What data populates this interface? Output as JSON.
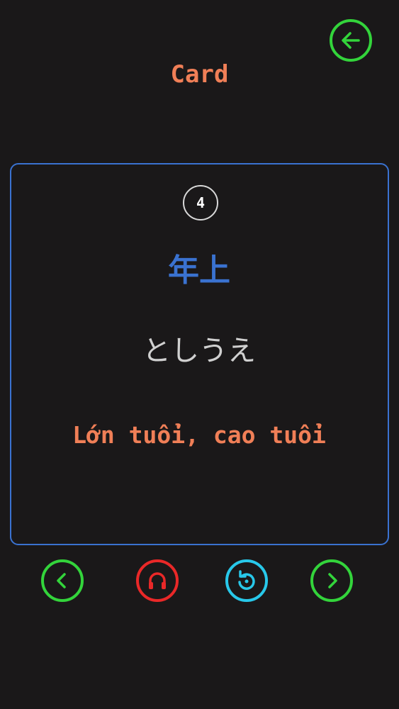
{
  "header": {
    "title": "Card"
  },
  "card": {
    "number": "4",
    "kanji": "年上",
    "reading": "としうえ",
    "meaning": "Lớn tuổi, cao tuổi"
  },
  "controls": {
    "back_icon": "arrow-left-icon",
    "prev_icon": "chevron-left-icon",
    "audio_icon": "headphones-icon",
    "flip_icon": "rotate-icon",
    "next_icon": "chevron-right-icon"
  },
  "colors": {
    "background": "#1a1819",
    "title": "#f07f57",
    "card_border": "#3a72d0",
    "kanji": "#3a72d0",
    "reading": "#d0d0d0",
    "meaning": "#f07f57",
    "nav_green": "#33d43b",
    "audio_red": "#ea2828",
    "flip_cyan": "#28c8ea"
  }
}
